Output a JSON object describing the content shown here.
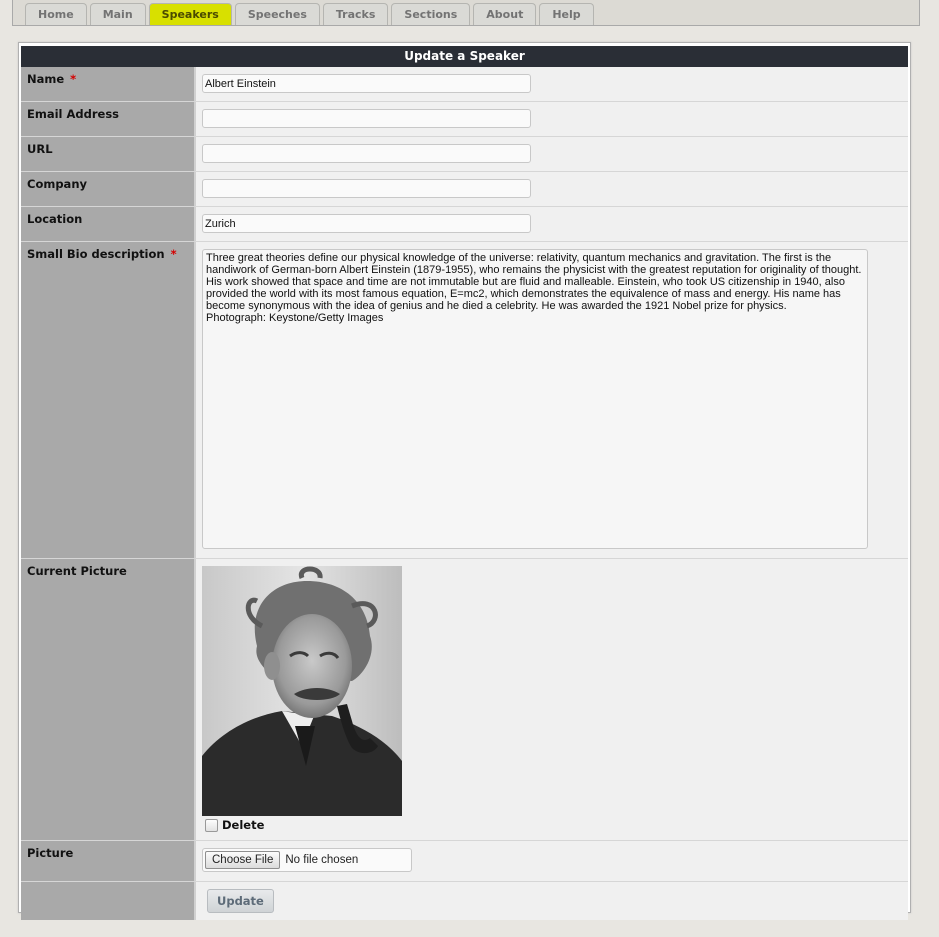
{
  "nav": {
    "tabs": [
      {
        "label": "Home"
      },
      {
        "label": "Main"
      },
      {
        "label": "Speakers"
      },
      {
        "label": "Speeches"
      },
      {
        "label": "Tracks"
      },
      {
        "label": "Sections"
      },
      {
        "label": "About"
      },
      {
        "label": "Help"
      }
    ],
    "active_tab": "Speakers",
    "active_color": "#d8e000"
  },
  "form": {
    "title": "Update a Speaker",
    "required_marker": "*",
    "fields": {
      "name": {
        "label": "Name",
        "value": "Albert Einstein",
        "required": true
      },
      "email": {
        "label": "Email Address",
        "value": ""
      },
      "url": {
        "label": "URL",
        "value": ""
      },
      "company": {
        "label": "Company",
        "value": ""
      },
      "location": {
        "label": "Location",
        "value": "Zurich"
      },
      "bio": {
        "label": "Small Bio description",
        "required": true,
        "value": "Three great theories define our physical knowledge of the universe: relativity, quantum mechanics and gravitation. The first is the\nhandiwork of German-born Albert Einstein (1879-1955), who remains the physicist with the greatest reputation for originality of thought.\nHis work showed that space and time are not immutable but are fluid and malleable. Einstein, who took US citizenship in 1940, also\nprovided the world with its most famous equation, E=mc2, which demonstrates the equivalence of mass and energy. His name has\nbecome synonymous with the idea of genius and he died a celebrity. He was awarded the 1921 Nobel prize for physics.\nPhotograph: Keystone/Getty Images"
      },
      "current_picture": {
        "label": "Current Picture",
        "delete_label": "Delete",
        "delete_checked": false
      },
      "picture": {
        "label": "Picture",
        "button_label": "Choose File",
        "status": "No file chosen"
      }
    },
    "submit_label": "Update"
  }
}
